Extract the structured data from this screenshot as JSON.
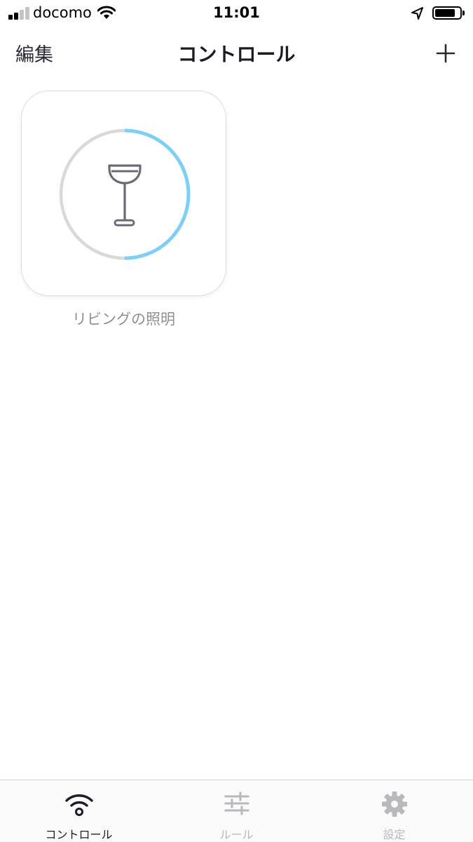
{
  "status_bar": {
    "carrier": "docomo",
    "time": "11:01"
  },
  "nav": {
    "edit_label": "編集",
    "title": "コントロール",
    "add_icon": "plus-icon"
  },
  "devices": [
    {
      "name": "リビングの照明",
      "icon": "floor-lamp-icon",
      "level_percent": 50
    }
  ],
  "tab_bar": {
    "tabs": [
      {
        "label": "コントロール",
        "icon": "wifi-icon",
        "active": true
      },
      {
        "label": "ルール",
        "icon": "sliders-icon",
        "active": false
      },
      {
        "label": "設定",
        "icon": "gear-icon",
        "active": false
      }
    ]
  },
  "colors": {
    "gauge_active": "#7ecff5",
    "gauge_track": "#d9d9d9",
    "icon_gray": "#6b6b75",
    "tab_inactive": "#b8b8bd"
  }
}
